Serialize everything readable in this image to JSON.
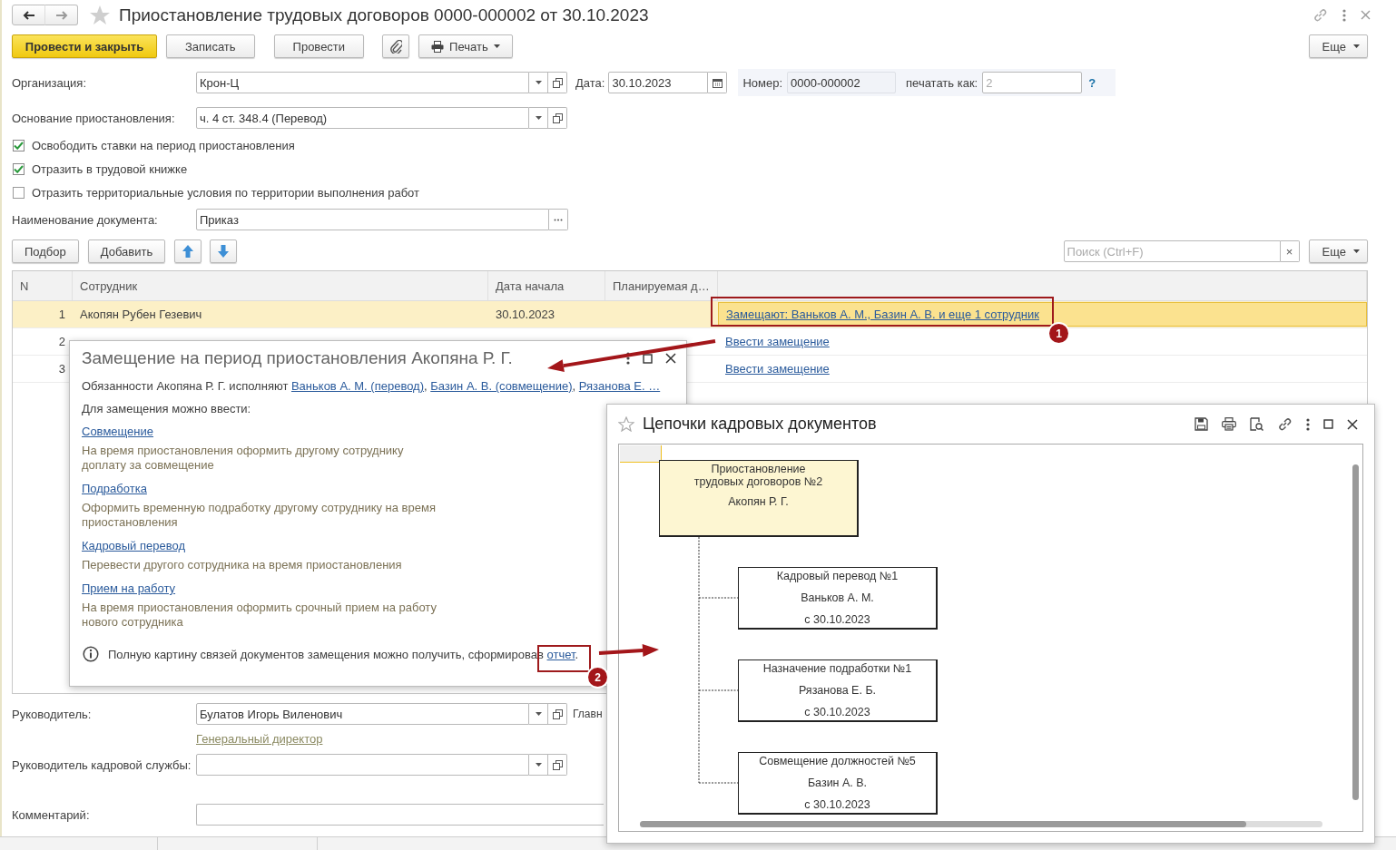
{
  "window": {
    "title": "Приостановление трудовых договоров 0000-000002 от 30.10.2023"
  },
  "toolbar": {
    "buttons": [
      {
        "kind": "primary",
        "label": "Провести и закрыть"
      },
      {
        "kind": "plain",
        "label": "Записать"
      },
      {
        "kind": "plain",
        "label": "Провести"
      },
      {
        "kind": "attach"
      },
      {
        "kind": "menu",
        "label": "Печать"
      }
    ],
    "more": "Еще"
  },
  "organization": {
    "label": "Организация:",
    "value": "Крон-Ц"
  },
  "date": {
    "label": "Дата:",
    "value": "30.10.2023"
  },
  "number": {
    "label": "Номер:",
    "value": "0000-000002"
  },
  "print_as": {
    "label": "печатать как:",
    "placeholder": "2"
  },
  "help": "?",
  "basis": {
    "label": "Основание приостановления:",
    "value": "ч. 4 ст. 348.4 (Перевод)"
  },
  "checkboxes": [
    {
      "label": "Освободить ставки на период приостановления",
      "checked": true
    },
    {
      "label": "Отразить в трудовой книжке",
      "checked": true
    },
    {
      "label": "Отразить территориальные условия по территории выполнения работ",
      "checked": false
    }
  ],
  "document_name": {
    "label": "Наименование документа:",
    "value": "Приказ"
  },
  "table_toolbar": {
    "buttons": [
      "Подбор",
      "Добавить"
    ],
    "search_placeholder": "Поиск (Ctrl+F)",
    "clear": "×",
    "more": "Еще"
  },
  "table": {
    "columns": [
      "N",
      "Сотрудник",
      "Дата начала",
      "Планируемая д…"
    ],
    "rows": [
      {
        "n": "1",
        "employee": "Акопян Рубен Гезевич",
        "start": "30.10.2023",
        "substitution": "Замещают: Ваньков А. М., Базин А. В. и еще 1 сотрудник",
        "selected": true
      },
      {
        "n": "2",
        "substitution": "Ввести замещение",
        "selected": false
      },
      {
        "n": "3",
        "substitution": "Ввести замещение",
        "selected": false
      }
    ]
  },
  "manager": {
    "label": "Руководитель:",
    "value": "Булатов Игорь Виленович",
    "position": "Генеральный директор",
    "next_label": "Главн"
  },
  "hr_head": {
    "label": "Руководитель кадровой службы:"
  },
  "comment": {
    "label": "Комментарий:"
  },
  "popup": {
    "title": "Замещение на период приостановления Акопяна Р. Г.",
    "duties": {
      "text": "Обязанности Акопяна Р. Г. исполняют",
      "separator": ",",
      "links": [
        "Ваньков А. М. (перевод)",
        "Базин А. В. (совмещение)",
        "Рязанова Е. …"
      ]
    },
    "options_heading": "Для замещения можно ввести:",
    "options": [
      {
        "link": "Совмещение",
        "description": "На время приостановления оформить другому сотруднику доплату за совмещение"
      },
      {
        "link": "Подработка",
        "description": "Оформить временную подработку другому сотруднику на время приостановления"
      },
      {
        "link": "Кадровый перевод",
        "description": "Перевести другого сотрудника на время приостановления"
      },
      {
        "link": "Прием на работу",
        "description": "На время приостановления оформить срочный прием на работу нового сотрудника"
      }
    ],
    "note": {
      "text": "Полную картину связей документов замещения можно получить, сформировав",
      "link": "отчет",
      "end": "."
    }
  },
  "chain_window": {
    "title": "Цепочки кадровых документов",
    "chain": {
      "title": "Приостановление трудовых договоров №2",
      "employee": "Акопян Р. Г.",
      "children": [
        {
          "title": "Кадровый перевод №1",
          "employee": "Ваньков А. М.",
          "date": "с 30.10.2023"
        },
        {
          "title": "Назначение подработки №1",
          "employee": "Рязанова Е. Б.",
          "date": "с 30.10.2023"
        },
        {
          "title": "Совмещение должностей №5",
          "employee": "Базин А. В.",
          "date": "с 30.10.2023"
        }
      ]
    }
  },
  "callouts": [
    {
      "number": "1"
    },
    {
      "number": "2"
    }
  ]
}
